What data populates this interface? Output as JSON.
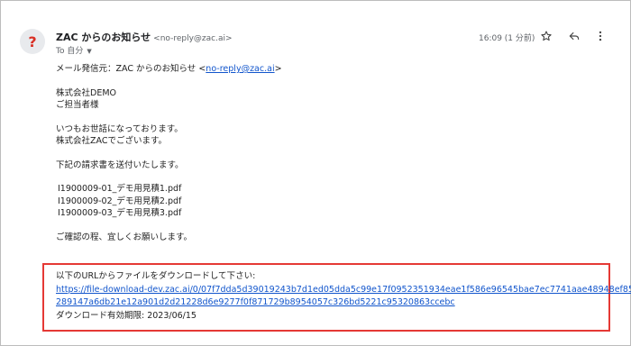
{
  "header": {
    "avatar_glyph": "?",
    "sender_name": "ZAC からのお知らせ",
    "sender_email": "<no-reply@zac.ai>",
    "to_label": "To 自分",
    "time": "16:09 (1 分前)"
  },
  "body": {
    "line_from_prefix": "メール発信元：ZAC からのお知らせ <",
    "line_from_link": "no-reply@zac.ai",
    "line_from_suffix": ">",
    "company": "株式会社DEMO",
    "recipient": "ご担当者様",
    "greeting1": "いつもお世話になっております。",
    "greeting2": "株式会社ZACでございます。",
    "intro": "下記の請求書を送付いたします。",
    "attachments": [
      "I1900009-01_デモ用見積1.pdf",
      "I1900009-02_デモ用見積2.pdf",
      "I1900009-03_デモ用見積3.pdf"
    ],
    "closing": "ご確認の程、宜しくお願いします。"
  },
  "download": {
    "instruction": "以下のURLからファイルをダウンロードして下さい:",
    "url_line1": "https://file-download-dev.zac.ai/0/07f7dda5d39019243b7d1ed05dda5c99e17f0952351934eae1f586e96545bae7ec7741aae48948ef85d69",
    "url_line2": "289147a6db21e12a901d2d21228d6e9277f0f871729b8954057c326bd5221c95320863ccebc",
    "expiry": "ダウンロード有効期限: 2023/06/15"
  },
  "colors": {
    "link": "#1155cc",
    "highlight_border": "#e53935",
    "avatar_glyph": "#d93025"
  },
  "icons": [
    "star-icon",
    "reply-icon",
    "more-vert-icon",
    "chevron-down-icon"
  ]
}
